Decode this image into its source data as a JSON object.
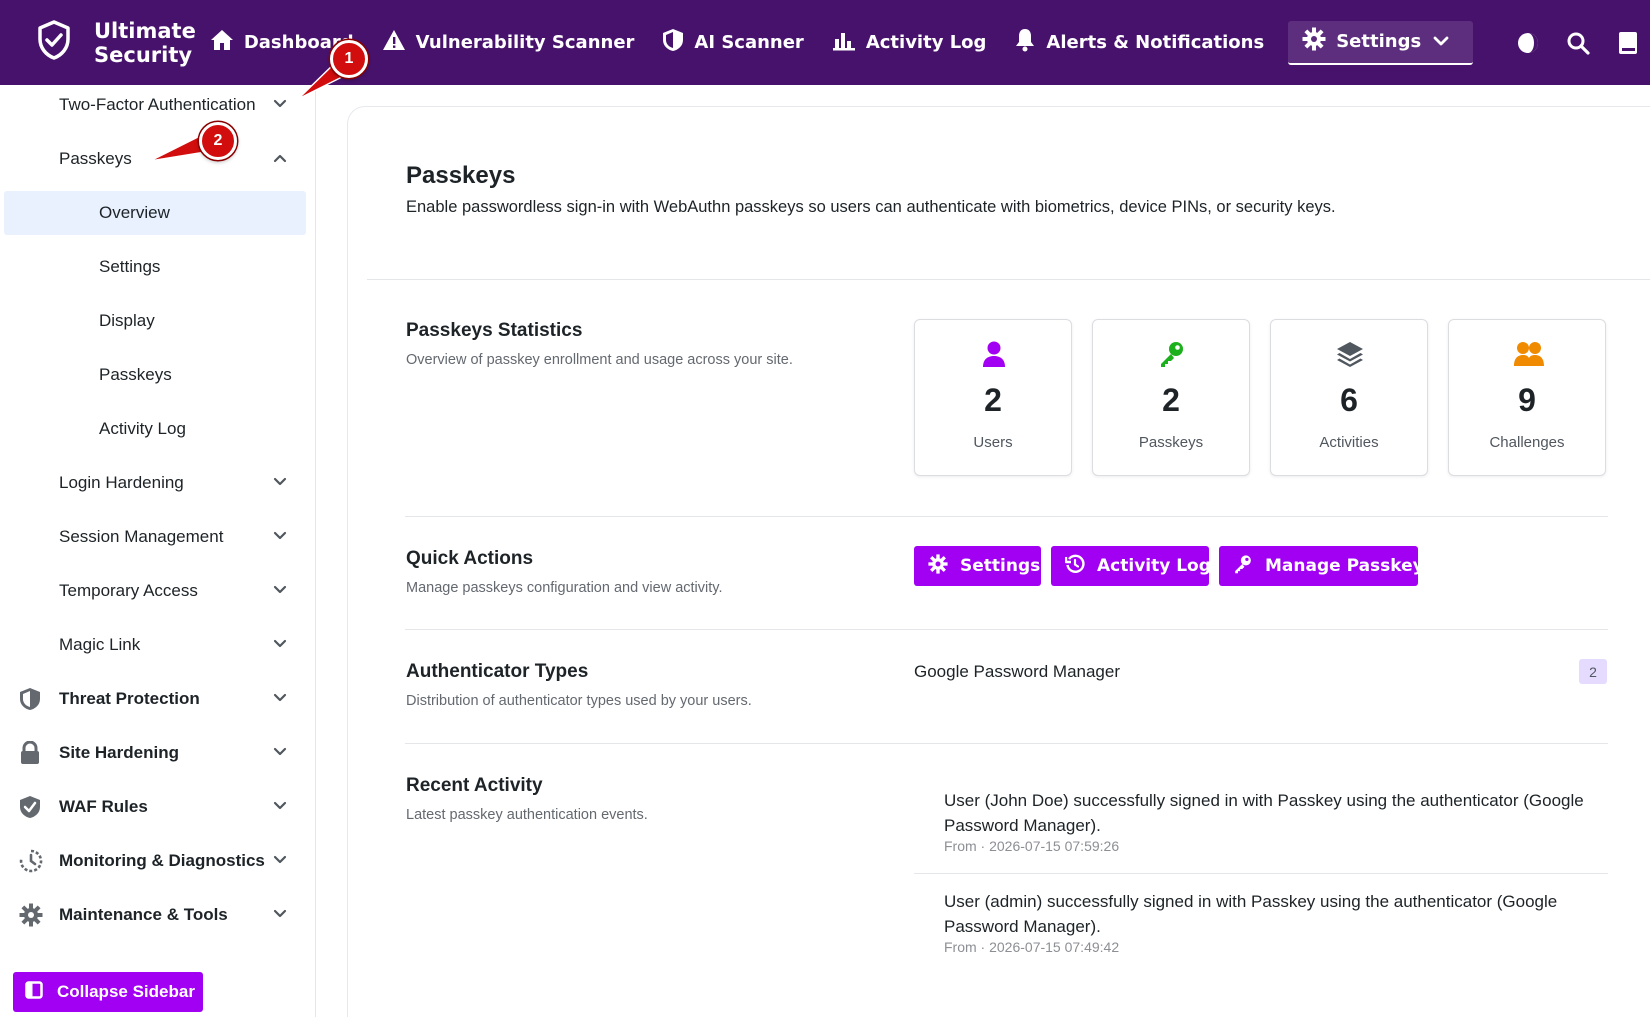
{
  "header": {
    "brand": "Ultimate Security",
    "nav": [
      {
        "label": "Dashboard",
        "icon": "home-icon"
      },
      {
        "label": "Vulnerability Scanner",
        "icon": "warning-icon"
      },
      {
        "label": "AI Scanner",
        "icon": "shield-icon"
      },
      {
        "label": "Activity Log",
        "icon": "bar-chart-icon"
      },
      {
        "label": "Alerts & Notifications",
        "icon": "bell-icon"
      },
      {
        "label": "Settings",
        "icon": "gear-icon"
      }
    ],
    "tools": [
      "theme-toggle-icon",
      "search-icon",
      "book-icon"
    ]
  },
  "sidebar": {
    "two_factor": "Two-Factor Authentication",
    "passkeys": "Passkeys",
    "passkeys_children": [
      "Overview",
      "Settings",
      "Display",
      "Passkeys",
      "Activity Log"
    ],
    "login_hardening": "Login Hardening",
    "session_management": "Session Management",
    "temporary_access": "Temporary Access",
    "magic_link": "Magic Link",
    "threat_protection": "Threat Protection",
    "site_hardening": "Site Hardening",
    "waf_rules": "WAF Rules",
    "monitoring": "Monitoring & Diagnostics",
    "maintenance": "Maintenance & Tools",
    "collapse": "Collapse Sidebar"
  },
  "main": {
    "title": "Passkeys",
    "description": "Enable passwordless sign-in with WebAuthn passkeys so users can authenticate with biometrics, device PINs, or security keys.",
    "statistics": {
      "title": "Passkeys Statistics",
      "description": "Overview of passkey enrollment and usage across your site.",
      "cards": [
        {
          "value": "2",
          "label": "Users",
          "icon": "user-icon",
          "color": "#a100f2"
        },
        {
          "value": "2",
          "label": "Passkeys",
          "icon": "key-icon",
          "color": "#1cb01c"
        },
        {
          "value": "6",
          "label": "Activities",
          "icon": "layers-icon",
          "color": "#50575e"
        },
        {
          "value": "9",
          "label": "Challenges",
          "icon": "users-icon",
          "color": "#f08a00"
        }
      ]
    },
    "quick_actions": {
      "title": "Quick Actions",
      "description": "Manage passkeys configuration and view activity.",
      "buttons": [
        "Settings",
        "Activity Log",
        "Manage Passkeys"
      ]
    },
    "authenticator_types": {
      "title": "Authenticator Types",
      "description": "Distribution of authenticator types used by your users.",
      "items": [
        {
          "name": "Google Password Manager",
          "count": "2"
        }
      ]
    },
    "recent_activity": {
      "title": "Recent Activity",
      "description": "Latest passkey authentication events.",
      "items": [
        {
          "message": "User (John Doe) successfully signed in with Passkey using the authenticator (Google Password Manager).",
          "meta": "From · 2026-07-15 07:59:26"
        },
        {
          "message": "User (admin) successfully signed in with Passkey using the authenticator (Google Password Manager).",
          "meta": "From · 2026-07-15 07:49:42"
        }
      ]
    }
  },
  "annotations": [
    {
      "number": "1"
    },
    {
      "number": "2"
    }
  ],
  "colors": {
    "header_bg": "#47126b",
    "accent": "#a100f2",
    "callout": "#d10d0d",
    "active_bg": "#e8f1fd"
  }
}
